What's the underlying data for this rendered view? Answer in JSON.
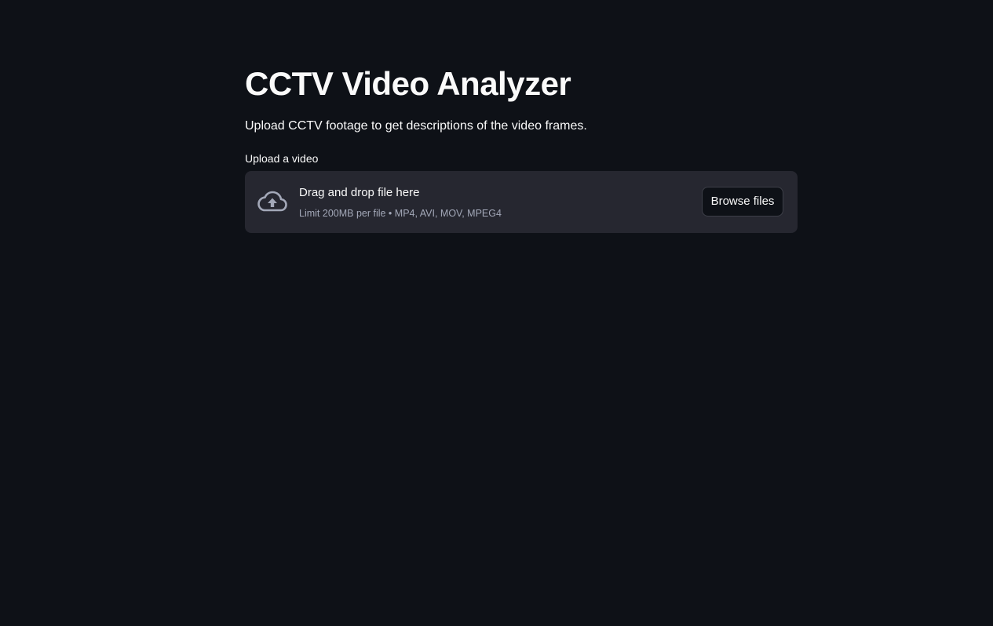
{
  "page": {
    "title": "CCTV Video Analyzer",
    "subtitle": "Upload CCTV footage to get descriptions of the video frames."
  },
  "uploader": {
    "label": "Upload a video",
    "drop_text": "Drag and drop file here",
    "limit_text": "Limit 200MB per file • MP4, AVI, MOV, MPEG4",
    "browse_label": "Browse files",
    "icon": "cloud-upload-icon"
  },
  "colors": {
    "background": "#0e1117",
    "dropzone": "#262730",
    "text": "#fafafa",
    "muted_text": "#a3a8b8"
  }
}
